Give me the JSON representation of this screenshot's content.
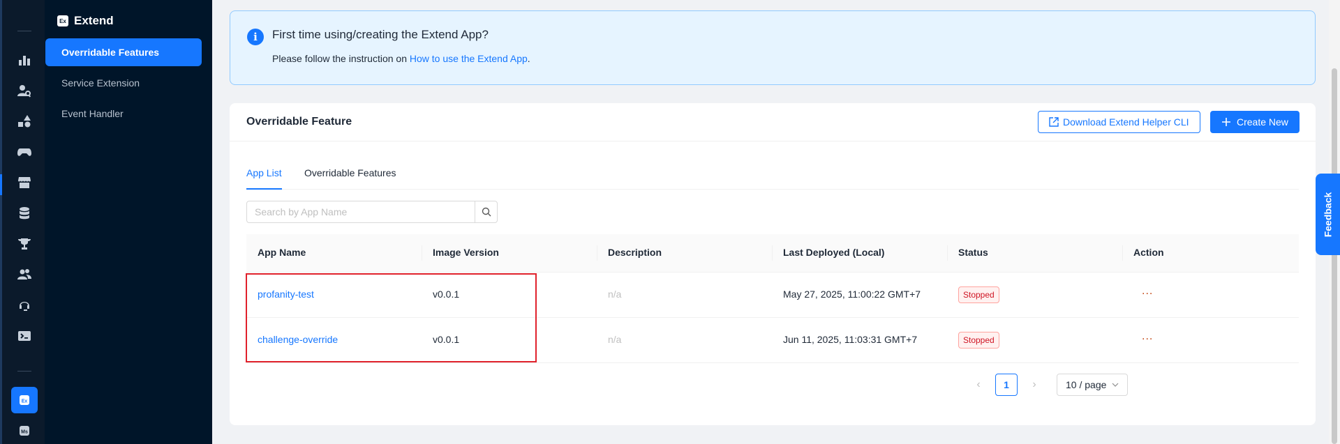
{
  "rail": {
    "icons": [
      "analytics-icon",
      "user-search-icon",
      "shapes-icon",
      "gamepad-icon",
      "store-icon",
      "database-icon",
      "trophy-icon",
      "users-icon",
      "headset-icon",
      "terminal-icon",
      "extend-icon",
      "ms-icon"
    ],
    "extend_badge": "Ex",
    "ms_badge": "Ms"
  },
  "sidebar": {
    "brand": "Extend",
    "brand_logo": "Ex",
    "items": [
      {
        "label": "Overridable Features",
        "active": true
      },
      {
        "label": "Service Extension",
        "active": false
      },
      {
        "label": "Event Handler",
        "active": false
      }
    ]
  },
  "banner": {
    "title": "First time using/creating the Extend App?",
    "desc_prefix": "Please follow the instruction on ",
    "desc_link": "How to use the Extend App",
    "desc_suffix": "."
  },
  "card": {
    "title": "Overridable Feature",
    "download_label": "Download Extend Helper CLI",
    "create_label": "Create New",
    "tabs": [
      {
        "label": "App List",
        "active": true
      },
      {
        "label": "Overridable Features",
        "active": false
      }
    ],
    "search": {
      "placeholder": "Search by App Name",
      "value": ""
    },
    "columns": [
      "App Name",
      "Image Version",
      "Description",
      "Last Deployed (Local)",
      "Status",
      "Action"
    ],
    "rows": [
      {
        "app_name": "profanity-test",
        "image_version": "v0.0.1",
        "description": "n/a",
        "last_deployed": "May 27, 2025, 11:00:22 GMT+7",
        "status": "Stopped",
        "action": "..."
      },
      {
        "app_name": "challenge-override",
        "image_version": "v0.0.1",
        "description": "n/a",
        "last_deployed": "Jun 11, 2025, 11:03:31 GMT+7",
        "status": "Stopped",
        "action": "..."
      }
    ],
    "pagination": {
      "current_page": "1",
      "page_size": "10 / page"
    }
  },
  "feedback_label": "Feedback",
  "colors": {
    "accent": "#1677ff",
    "sidebar_bg": "#001529",
    "rail_bg": "#0b1a2b",
    "danger": "#cf1322",
    "highlight": "#e0212b"
  }
}
